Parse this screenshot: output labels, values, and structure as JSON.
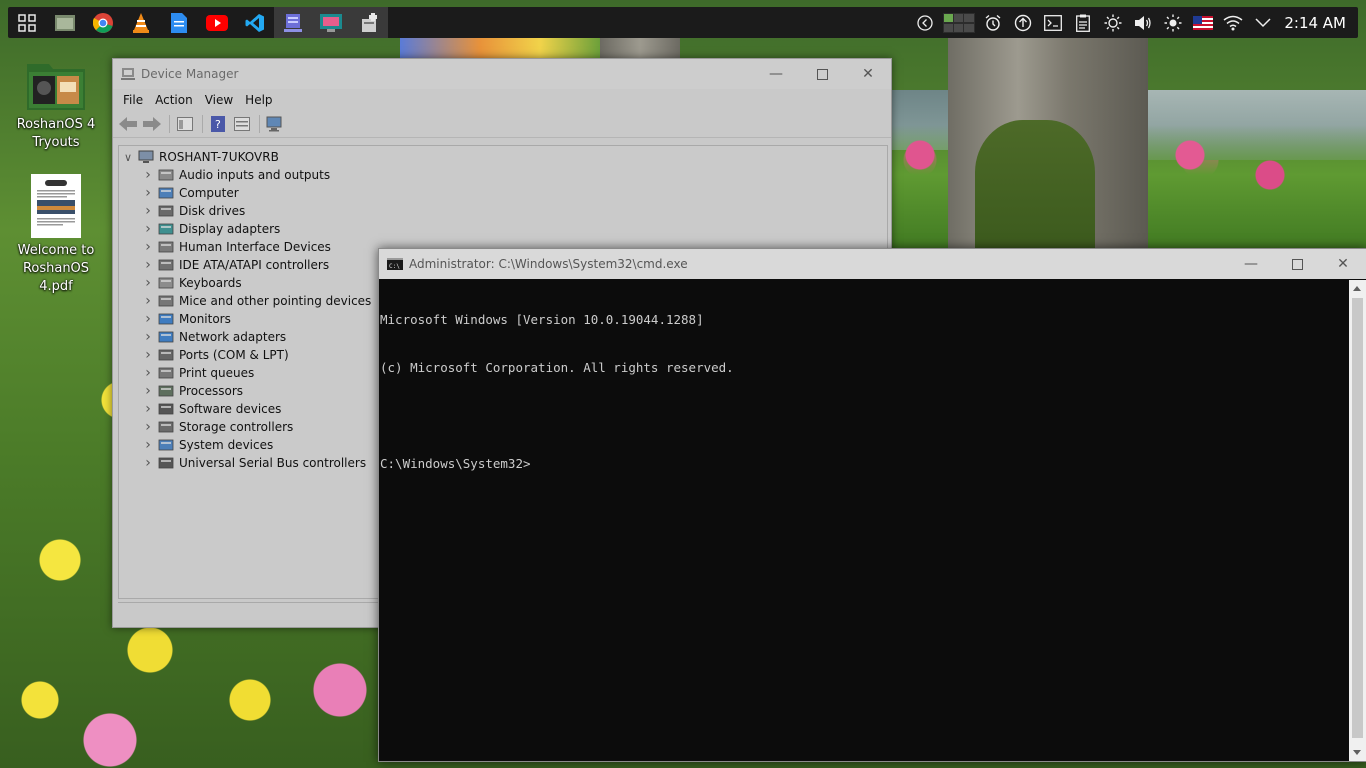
{
  "taskbar": {
    "apps": [
      {
        "icon": "start-grid-icon"
      },
      {
        "icon": "file-manager-icon"
      },
      {
        "icon": "chrome-icon"
      },
      {
        "icon": "vlc-icon"
      },
      {
        "icon": "notepad-icon"
      },
      {
        "icon": "youtube-icon"
      },
      {
        "icon": "vscode-icon"
      },
      {
        "icon": "device-manager-icon"
      },
      {
        "icon": "display-app-icon"
      },
      {
        "icon": "cmd-app-icon"
      }
    ],
    "tray": [
      "back-chevron-icon",
      "workspace-grid-icon",
      "alarm-icon",
      "update-icon",
      "terminal-icon",
      "clipboard-icon",
      "brightness-icon",
      "volume-icon",
      "night-light-icon",
      "us-flag-icon",
      "wifi-icon",
      "overflow-chevron-icon"
    ],
    "clock": "2:14 AM"
  },
  "desktop": {
    "items": [
      {
        "label": "RoshanOS 4 Tryouts",
        "icon": "folder-icon"
      },
      {
        "label": "Welcome to RoshanOS 4.pdf",
        "icon": "pdf-document-icon"
      }
    ]
  },
  "device_manager": {
    "title": "Device Manager",
    "menu": [
      "File",
      "Action",
      "View",
      "Help"
    ],
    "root": "ROSHANT-7UKOVRB",
    "categories": [
      {
        "label": "Audio inputs and outputs",
        "icon": "speaker-icon"
      },
      {
        "label": "Computer",
        "icon": "computer-icon"
      },
      {
        "label": "Disk drives",
        "icon": "disk-drive-icon"
      },
      {
        "label": "Display adapters",
        "icon": "display-adapter-icon"
      },
      {
        "label": "Human Interface Devices",
        "icon": "hid-icon"
      },
      {
        "label": "IDE ATA/ATAPI controllers",
        "icon": "ide-controller-icon"
      },
      {
        "label": "Keyboards",
        "icon": "keyboard-icon"
      },
      {
        "label": "Mice and other pointing devices",
        "icon": "mouse-icon"
      },
      {
        "label": "Monitors",
        "icon": "monitor-icon"
      },
      {
        "label": "Network adapters",
        "icon": "network-adapter-icon"
      },
      {
        "label": "Ports (COM & LPT)",
        "icon": "port-icon"
      },
      {
        "label": "Print queues",
        "icon": "printer-icon"
      },
      {
        "label": "Processors",
        "icon": "processor-icon"
      },
      {
        "label": "Software devices",
        "icon": "software-device-icon"
      },
      {
        "label": "Storage controllers",
        "icon": "storage-controller-icon"
      },
      {
        "label": "System devices",
        "icon": "system-device-icon"
      },
      {
        "label": "Universal Serial Bus controllers",
        "icon": "usb-icon"
      }
    ]
  },
  "cmd": {
    "title": "Administrator: C:\\Windows\\System32\\cmd.exe",
    "lines": [
      "Microsoft Windows [Version 10.0.19044.1288]",
      "(c) Microsoft Corporation. All rights reserved.",
      "",
      "C:\\Windows\\System32>"
    ]
  },
  "colors": {
    "taskbar": "#1b1b1b",
    "cmd_bg": "#0c0c0c",
    "cmd_text": "#cccccc",
    "window_bg": "#c9c9c9"
  }
}
